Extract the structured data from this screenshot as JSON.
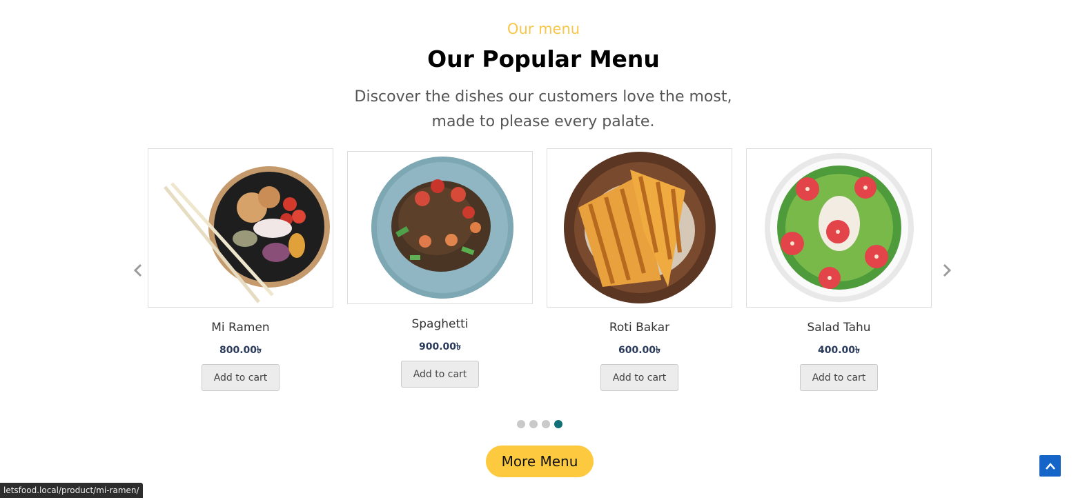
{
  "section": {
    "eyebrow": "Our menu",
    "title": "Our Popular Menu",
    "subtitle": "Discover the dishes our customers love the most, made to please every palate."
  },
  "products": [
    {
      "name": "Mi Ramen",
      "price": "800.00৳",
      "button": "Add to cart"
    },
    {
      "name": "Spaghetti",
      "price": "900.00৳",
      "button": "Add to cart"
    },
    {
      "name": "Roti Bakar",
      "price": "600.00৳",
      "button": "Add to cart"
    },
    {
      "name": "Salad Tahu",
      "price": "400.00৳",
      "button": "Add to cart"
    }
  ],
  "carousel": {
    "pages": 4,
    "active_page": 4
  },
  "more_button": "More Menu",
  "status_url": "letsfood.local/product/mi-ramen/",
  "colors": {
    "accent": "#fcc93f",
    "eyebrow": "#f7c64a",
    "dot_active": "#116f77",
    "to_top": "#1565c8"
  },
  "icons": [
    "chevron-left-icon",
    "chevron-right-icon",
    "arrow-up-icon"
  ]
}
